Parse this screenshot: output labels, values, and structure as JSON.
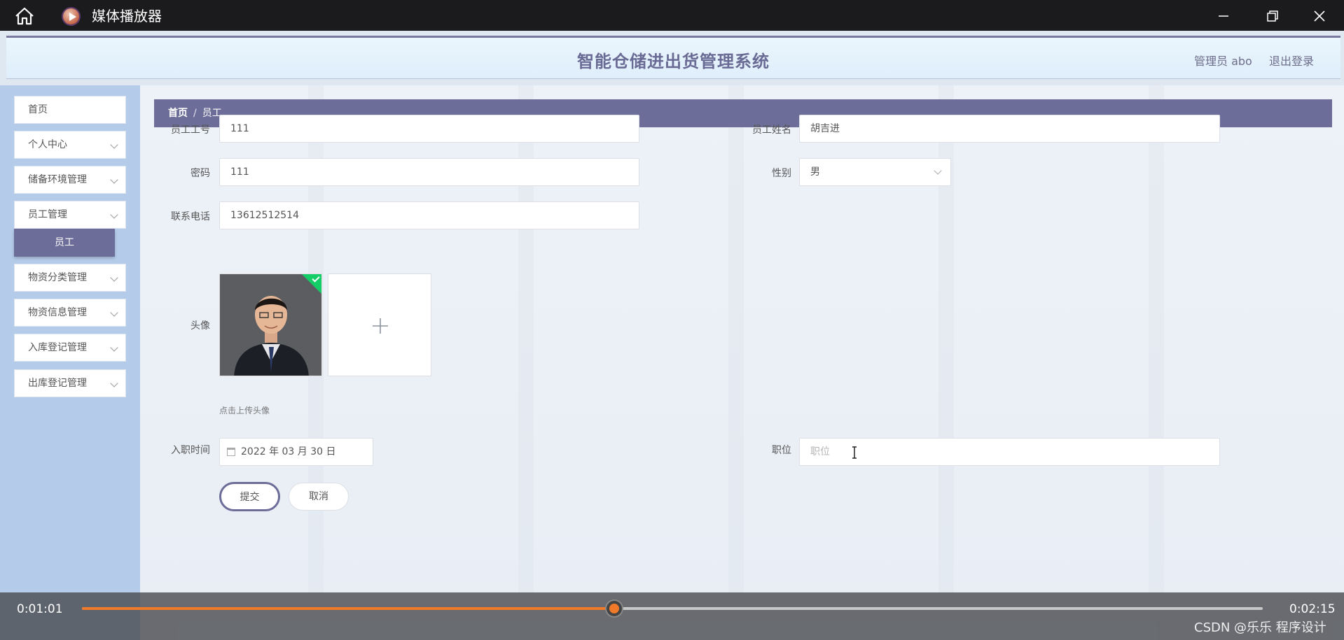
{
  "window": {
    "title": "媒体播放器",
    "icons": [
      "home-icon",
      "media-player-icon",
      "minimize-icon",
      "maximize-icon",
      "close-icon"
    ]
  },
  "header": {
    "system_title": "智能仓储进出货管理系统",
    "admin_label": "管理员 abo",
    "logout": "退出登录"
  },
  "sidebar": {
    "items": [
      {
        "label": "首页",
        "has_chevron": false
      },
      {
        "label": "个人中心",
        "has_chevron": true
      },
      {
        "label": "储备环境管理",
        "has_chevron": true
      },
      {
        "label": "员工管理",
        "has_chevron": true
      },
      {
        "label": "物资分类管理",
        "has_chevron": true
      },
      {
        "label": "物资信息管理",
        "has_chevron": true
      },
      {
        "label": "入库登记管理",
        "has_chevron": true
      },
      {
        "label": "出库登记管理",
        "has_chevron": true
      }
    ],
    "active_sub_item": "员工"
  },
  "breadcrumb": {
    "home": "首页",
    "separator": "/",
    "current": "员工"
  },
  "form": {
    "employee_id": {
      "label": "员工工号",
      "value": "111"
    },
    "employee_name": {
      "label": "员工姓名",
      "value": "胡吉进"
    },
    "password": {
      "label": "密码",
      "value": "111"
    },
    "gender": {
      "label": "性别",
      "value": "男"
    },
    "phone": {
      "label": "联系电话",
      "value": "13612512514"
    },
    "avatar": {
      "label": "头像",
      "hint": "点击上传头像"
    },
    "hire_date": {
      "label": "入职时间",
      "value": "2022 年 03 月 30 日"
    },
    "position": {
      "label": "职位",
      "placeholder": "职位"
    },
    "submit": "提交",
    "cancel": "取消"
  },
  "player": {
    "current_time": "0:01:01",
    "total_time": "0:02:15",
    "progress": 0.451,
    "watermark": "CSDN @乐乐 程序设计"
  },
  "colors": {
    "accent": "#6c6d98",
    "sidebar_bg": "#b4cbe9",
    "progress": "#f07a2a",
    "success": "#13ce66"
  }
}
